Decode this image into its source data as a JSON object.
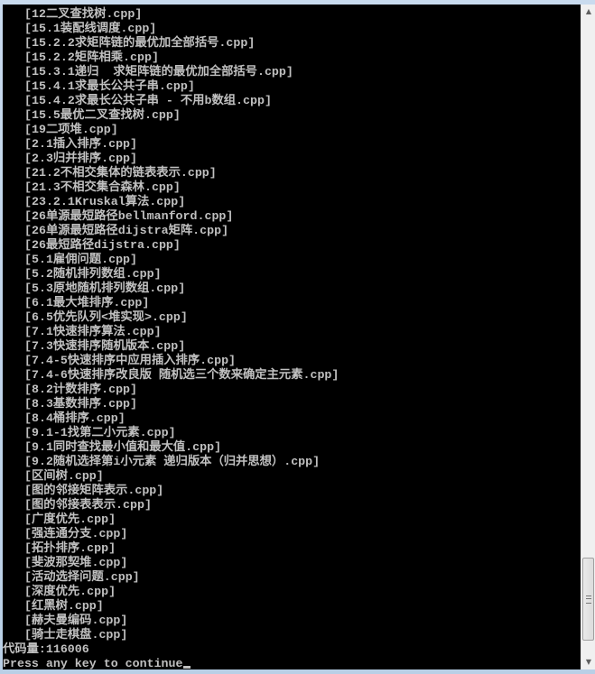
{
  "console": {
    "files": [
      "[12二叉查找树.cpp]",
      "[15.1装配线调度.cpp]",
      "[15.2.2求矩阵链的最优加全部括号.cpp]",
      "[15.2.2矩阵相乘.cpp]",
      "[15.3.1递归  求矩阵链的最优加全部括号.cpp]",
      "[15.4.1求最长公共子串.cpp]",
      "[15.4.2求最长公共子串 - 不用b数组.cpp]",
      "[15.5最优二叉查找树.cpp]",
      "[19二项堆.cpp]",
      "[2.1插入排序.cpp]",
      "[2.3归并排序.cpp]",
      "[21.2不相交集体的链表表示.cpp]",
      "[21.3不相交集合森林.cpp]",
      "[23.2.1Kruskal算法.cpp]",
      "[26单源最短路径bellmanford.cpp]",
      "[26单源最短路径dijstra矩阵.cpp]",
      "[26最短路径dijstra.cpp]",
      "[5.1雇佣问题.cpp]",
      "[5.2随机排列数组.cpp]",
      "[5.3原地随机排列数组.cpp]",
      "[6.1最大堆排序.cpp]",
      "[6.5优先队列<堆实现>.cpp]",
      "[7.1快速排序算法.cpp]",
      "[7.3快速排序随机版本.cpp]",
      "[7.4-5快速排序中应用插入排序.cpp]",
      "[7.4-6快速排序改良版 随机选三个数来确定主元素.cpp]",
      "[8.2计数排序.cpp]",
      "[8.3基数排序.cpp]",
      "[8.4桶排序.cpp]",
      "[9.1-1找第二小元素.cpp]",
      "[9.1同时查找最小值和最大值.cpp]",
      "[9.2随机选择第i小元素 递归版本（归并思想）.cpp]",
      "[区间树.cpp]",
      "[图的邻接矩阵表示.cpp]",
      "[图的邻接表表示.cpp]",
      "[广度优先.cpp]",
      "[强连通分支.cpp]",
      "[拓扑排序.cpp]",
      "[斐波那契堆.cpp]",
      "[活动选择问题.cpp]",
      "[深度优先.cpp]",
      "[红黑树.cpp]",
      "[赫夫曼编码.cpp]",
      "[骑士走棋盘.cpp]"
    ],
    "code_count_line": "代码量:116006",
    "prompt": "Press any key to continue"
  },
  "scrollbar": {
    "position_percent": 100
  }
}
